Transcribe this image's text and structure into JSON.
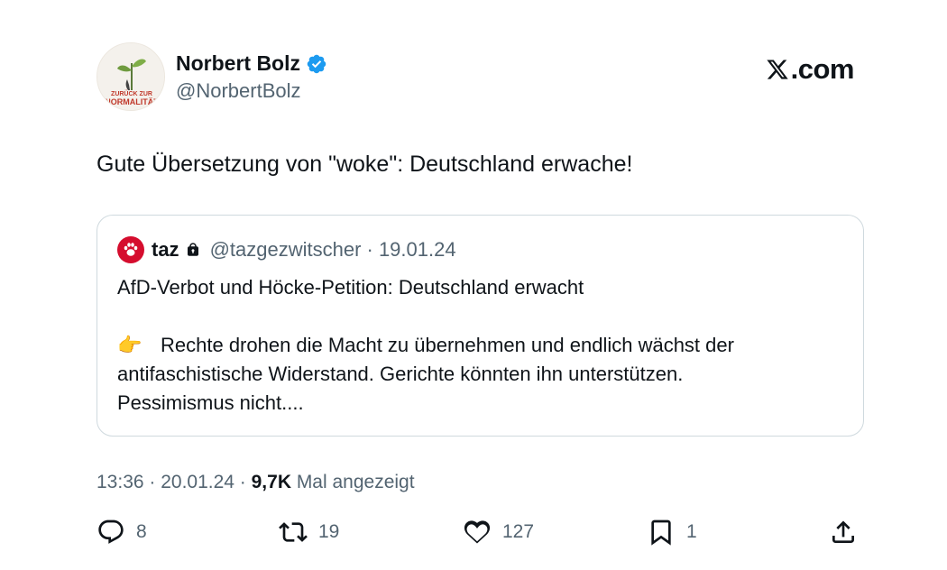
{
  "author": {
    "display_name": "Norbert Bolz",
    "handle": "@NorbertBolz",
    "avatar_text_top": "ZURÜCK ZUR",
    "avatar_text_bottom": "NORMALITÄT"
  },
  "brand": {
    "site": ".com"
  },
  "tweet": {
    "text": "Gute Übersetzung von \"woke\": Deutschland erwache!"
  },
  "quote": {
    "name": "taz",
    "handle_date": "@tazgezwitscher · 19.01.24",
    "line1": "AfD-Verbot und Höcke-Petition: Deutschland erwacht",
    "emoji": "👉",
    "line2": "Rechte drohen die Macht zu übernehmen und endlich wächst der",
    "line3": "antifaschistische Widerstand. Gerichte könnten ihn unterstützen.",
    "line4": "Pessimismus nicht...."
  },
  "meta": {
    "time_date": "13:36 · 20.01.24 · ",
    "views": "9,7K",
    "views_label": " Mal angezeigt"
  },
  "actions": {
    "replies": "8",
    "retweets": "19",
    "likes": "127",
    "bookmarks": "1"
  },
  "colors": {
    "verified": "#1d9bf0",
    "taz_red": "#d50d2e",
    "secondary_text": "#536471",
    "border": "#cfd9de"
  }
}
